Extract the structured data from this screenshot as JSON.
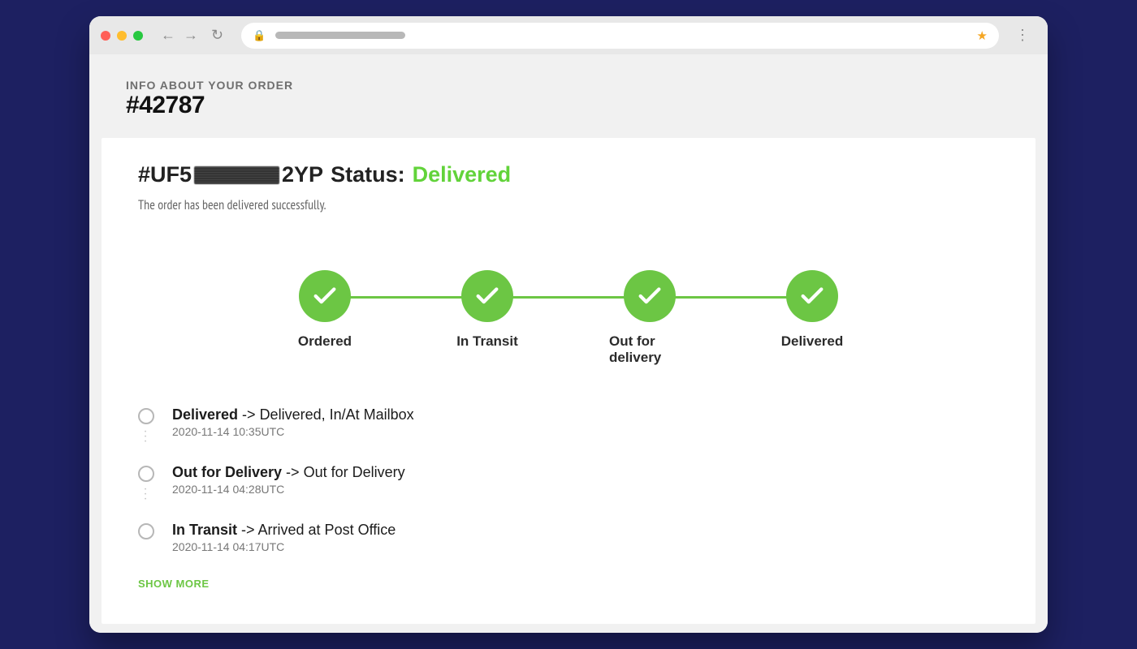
{
  "header": {
    "eyebrow": "INFO ABOUT YOUR ORDER",
    "order_number": "#42787"
  },
  "status": {
    "tracking_prefix": "#UF5",
    "tracking_suffix": "2YP",
    "status_label": "Status:",
    "status_value": "Delivered",
    "subtext": "The order has been delivered successfully."
  },
  "steps": [
    {
      "label": "Ordered",
      "done": true
    },
    {
      "label": "In Transit",
      "done": true
    },
    {
      "label": "Out for delivery",
      "done": true
    },
    {
      "label": "Delivered",
      "done": true
    }
  ],
  "events": [
    {
      "stage": "Delivered",
      "arrow": " -> ",
      "detail": "Delivered, In/At Mailbox",
      "time": "2020-11-14 10:35UTC"
    },
    {
      "stage": "Out for Delivery",
      "arrow": " -> ",
      "detail": "Out for Delivery",
      "time": "2020-11-14 04:28UTC"
    },
    {
      "stage": "In Transit",
      "arrow": " -> ",
      "detail": "Arrived at Post Office",
      "time": "2020-11-14 04:17UTC"
    }
  ],
  "show_more": "SHOW MORE",
  "colors": {
    "accent_green": "#6cc644",
    "status_green": "#62d33a"
  }
}
